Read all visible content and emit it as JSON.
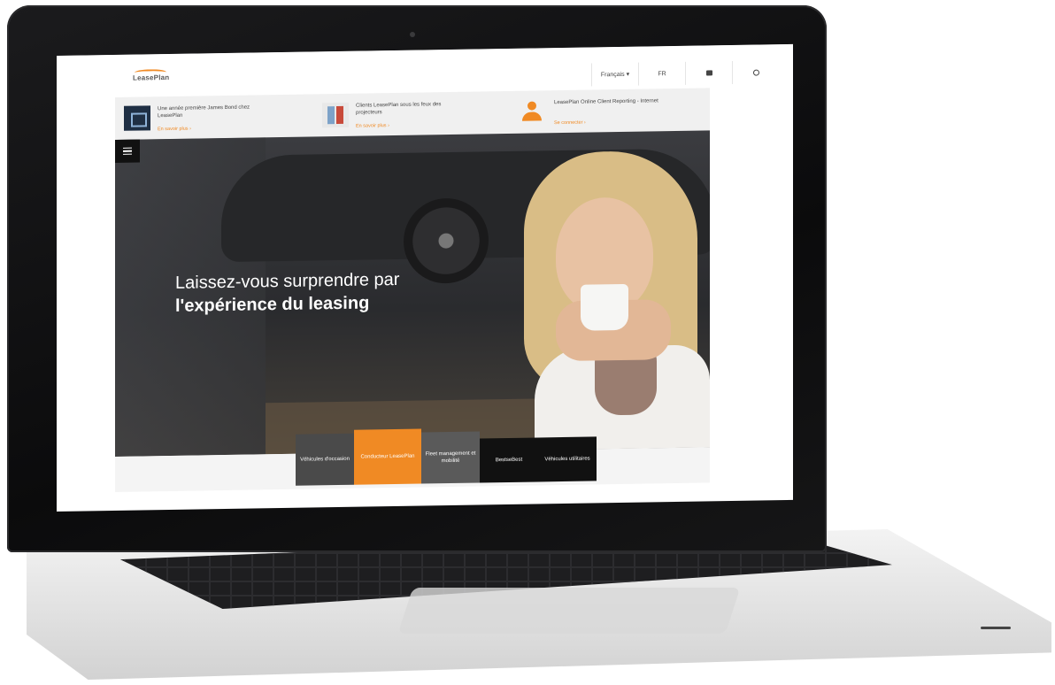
{
  "header": {
    "logo_text": "LeasePlan",
    "nav": {
      "language": "Français ▾",
      "lang_code": "FR"
    }
  },
  "promo": [
    {
      "title": "Une année première James Bond chez LeasePlan",
      "link": "En savoir plus ›"
    },
    {
      "title": "Clients LeasePlan sous les feux des projecteurs",
      "link": "En savoir plus ›"
    },
    {
      "title": "LeasePlan Online Client Reporting - Internet",
      "link": "Se connecter ›"
    }
  ],
  "hero": {
    "headline_line1": "Laissez-vous surprendre par",
    "headline_line2": "l'expérience du leasing"
  },
  "tabs": [
    {
      "label": "Véhicules d'occasion"
    },
    {
      "label": "Conducteur LeasePlan"
    },
    {
      "label": "Fleet management et mobilité"
    },
    {
      "label": "BestseBest"
    },
    {
      "label": "Véhicules utilitaires"
    }
  ],
  "colors": {
    "accent": "#f08a24"
  }
}
